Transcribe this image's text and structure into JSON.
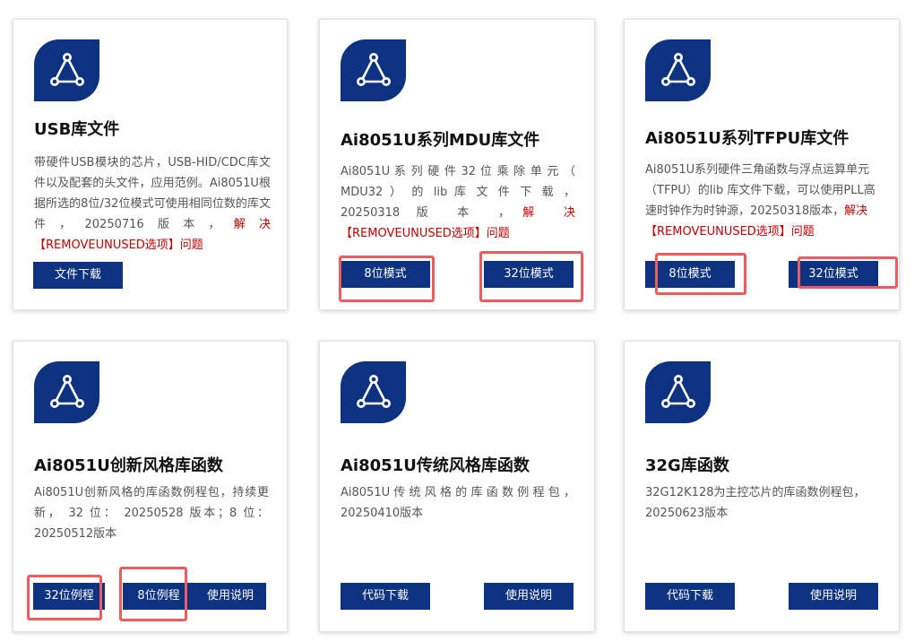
{
  "cards": [
    {
      "icon": "network-triangle-icon",
      "title": "USB库文件",
      "desc_main": "带硬件USB模块的芯片，USB-HID/CDC库文件以及配套的头文件，应用范例。Ai8051U根据所选的8位/32位模式可使用相同位数的库文件，20250716版本，",
      "desc_red": "解决【REMOVEUNUSED选项】问题",
      "buttons": [
        "文件下载"
      ]
    },
    {
      "icon": "network-triangle-icon",
      "title": "Ai8051U系列MDU库文件",
      "desc_main": "Ai8051U 系 列 硬 件 32 位 乘 除 单 元 （ MDU32 ） 的 lib 库 文 件 下 载 ， 20250318 版 本 ，",
      "desc_red": "解 决【REMOVEUNUSED选项】问题",
      "buttons": [
        "8位模式",
        "32位模式"
      ]
    },
    {
      "icon": "network-triangle-icon",
      "title": "Ai8051U系列TFPU库文件",
      "desc_main": "Ai8051U系列硬件三角函数与浮点运算单元（TFPU）的lib 库文件下载，可以使用PLL高速时钟作为时钟源，20250318版本，",
      "desc_red": "解决【REMOVEUNUSED选项】问题",
      "buttons": [
        "8位模式",
        "32位模式"
      ]
    },
    {
      "icon": "network-triangle-icon",
      "title": "Ai8051U创新风格库函数",
      "desc_main": "Ai8051U创新风格的库函数例程包，持续更新， 32 位： 20250528 版本；8 位：20250512版本",
      "desc_red": "",
      "buttons": [
        "32位例程",
        "8位例程",
        "使用说明"
      ]
    },
    {
      "icon": "network-triangle-icon",
      "title": "Ai8051U传统风格库函数",
      "desc_main": "Ai8051U 传 统 风 格 的 库 函 数 例 程 包 ，20250410版本",
      "desc_red": "",
      "buttons": [
        "代码下载",
        "使用说明"
      ]
    },
    {
      "icon": "network-triangle-icon",
      "title": "32G库函数",
      "desc_main": "32G12K128为主控芯片的库函数例程包，20250623版本",
      "desc_red": "",
      "buttons": [
        "代码下载",
        "使用说明"
      ]
    }
  ],
  "colors": {
    "brand": "#0d3280",
    "highlight": "#ee5c62",
    "warning_text": "#c40000"
  }
}
